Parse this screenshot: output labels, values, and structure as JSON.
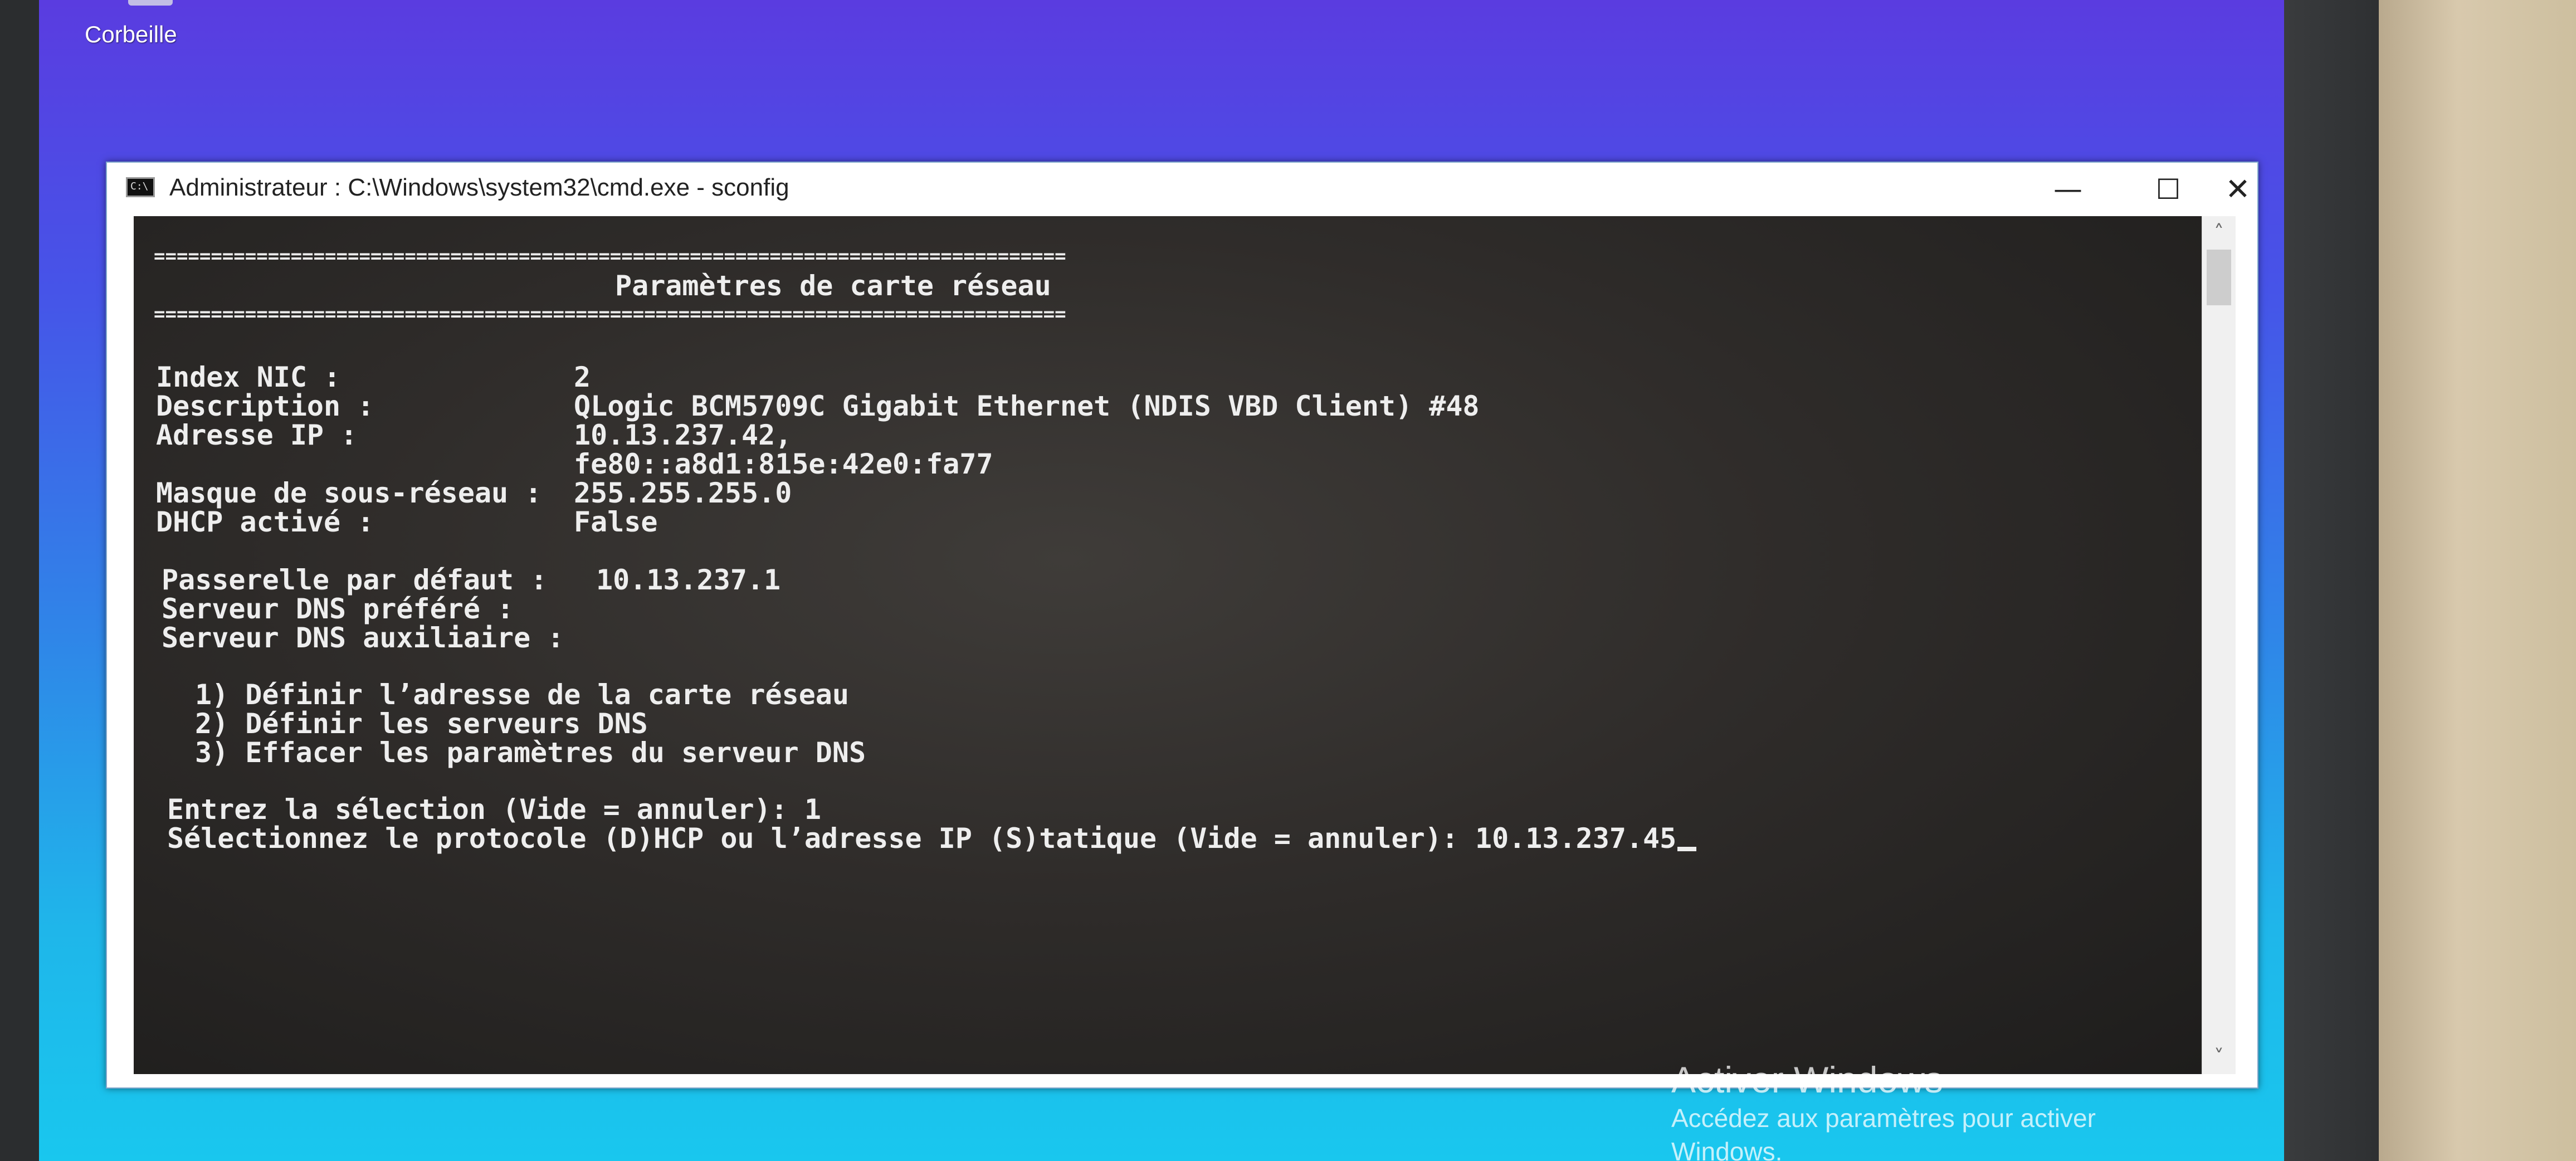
{
  "desktop": {
    "recycle_bin_label": "Corbeille"
  },
  "window": {
    "title": "Administrateur : C:\\Windows\\system32\\cmd.exe - sconfig",
    "icon_label": "C:\\",
    "minimize_glyph": "—",
    "maximize_glyph": "☐",
    "close_glyph": "✕"
  },
  "console": {
    "separator": "================================================================================",
    "heading": "Paramètres de carte réseau",
    "fields": [
      {
        "label": "Index NIC :",
        "value": "2"
      },
      {
        "label": "Description :",
        "value": "QLogic BCM5709C Gigabit Ethernet (NDIS VBD Client) #48"
      },
      {
        "label": "Adresse IP :",
        "value": "10.13.237.42,"
      },
      {
        "label": "",
        "value": "fe80::a8d1:815e:42e0:fa77"
      },
      {
        "label": "Masque de sous-réseau :",
        "value": "255.255.255.0"
      },
      {
        "label": "DHCP activé :",
        "value": "False"
      }
    ],
    "gateway_label": "Passerelle par défaut :",
    "gateway_value": "10.13.237.1",
    "dns_preferred_label": "Serveur DNS préféré :",
    "dns_aux_label": "Serveur DNS auxiliaire :",
    "menu": [
      "1) Définir l’adresse de la carte réseau",
      "2) Définir les serveurs DNS",
      "3) Effacer les paramètres du serveur DNS"
    ],
    "prompt_selection": "Entrez la sélection (Vide = annuler): 1",
    "prompt_protocol": "Sélectionnez le protocole (D)HCP ou l’adresse IP (S)tatique (Vide = annuler): 10.13.237.45"
  },
  "scrollbar": {
    "up_glyph": "˄",
    "down_glyph": "˅"
  },
  "watermark": {
    "title": "Activer Windows",
    "subtitle": "Accédez aux paramètres pour activer",
    "subtitle2": "Windows."
  }
}
